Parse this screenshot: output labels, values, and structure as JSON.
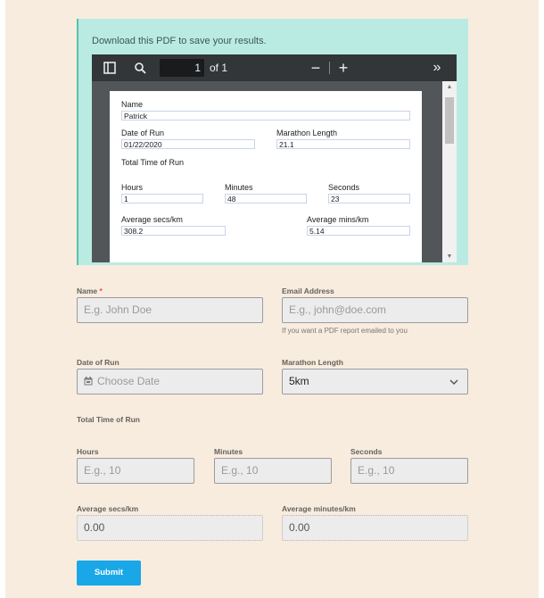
{
  "info": {
    "text": "Download this PDF to save your results."
  },
  "pdf": {
    "toolbar": {
      "page_current": "1",
      "page_of": "of 1"
    },
    "content": {
      "name_label": "Name",
      "name_value": "Patrick",
      "date_label": "Date of Run",
      "date_value": "01/22/2020",
      "marathon_label": "Marathon Length",
      "marathon_value": "21.1",
      "total_label": "Total Time of Run",
      "hours_label": "Hours",
      "hours_value": "1",
      "minutes_label": "Minutes",
      "minutes_value": "48",
      "seconds_label": "Seconds",
      "seconds_value": "23",
      "avg_secs_label": "Average secs/km",
      "avg_secs_value": "308.2",
      "avg_mins_label": "Average mins/km",
      "avg_mins_value": "5.14"
    }
  },
  "form": {
    "name": {
      "label": "Name",
      "required_mark": "*",
      "placeholder": "E.g. John Doe"
    },
    "email": {
      "label": "Email Address",
      "placeholder": "E.g., john@doe.com",
      "hint": "If you want a PDF report emailed to you"
    },
    "date": {
      "label": "Date of Run",
      "placeholder": "Choose Date"
    },
    "marathon": {
      "label": "Marathon Length",
      "value": "5km"
    },
    "total_time": {
      "label": "Total Time of Run"
    },
    "hours": {
      "label": "Hours",
      "placeholder": "E.g., 10"
    },
    "minutes": {
      "label": "Minutes",
      "placeholder": "E.g., 10"
    },
    "seconds": {
      "label": "Seconds",
      "placeholder": "E.g., 10"
    },
    "avg_secs": {
      "label": "Average secs/km",
      "value": "0.00"
    },
    "avg_mins": {
      "label": "Average minutes/km",
      "value": "0.00"
    },
    "submit_label": "Submit"
  }
}
